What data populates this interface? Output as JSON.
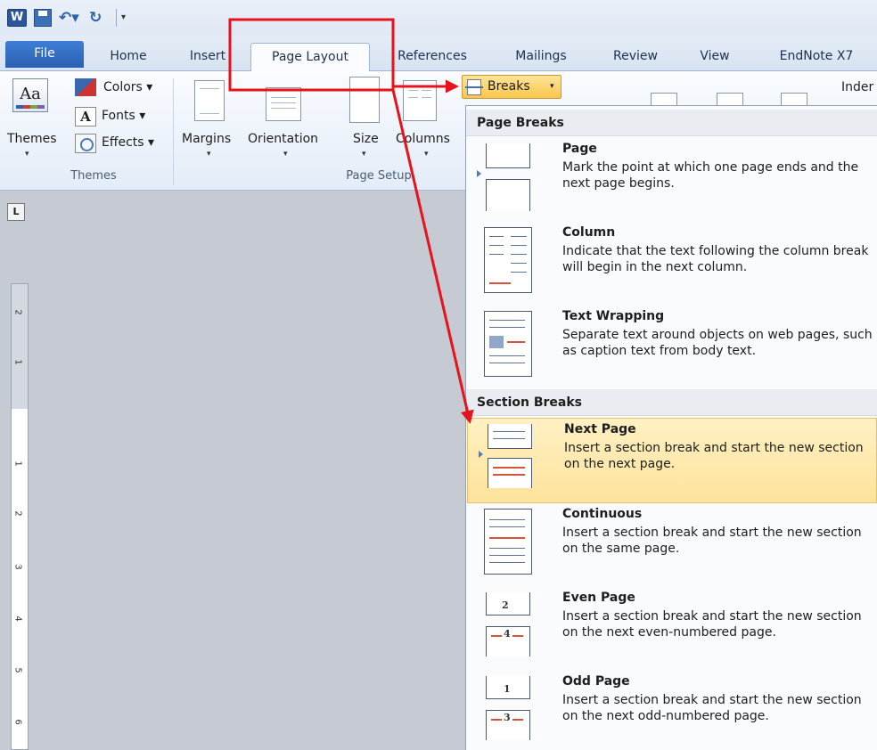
{
  "quick_access": {
    "word_icon": "W",
    "icons": [
      "word-icon",
      "save-icon",
      "undo-icon",
      "redo-icon",
      "customize-icon"
    ]
  },
  "tabs": [
    {
      "label": "File"
    },
    {
      "label": "Home"
    },
    {
      "label": "Insert"
    },
    {
      "label": "Page Layout"
    },
    {
      "label": "References"
    },
    {
      "label": "Mailings"
    },
    {
      "label": "Review"
    },
    {
      "label": "View"
    },
    {
      "label": "EndNote X7"
    }
  ],
  "ribbon": {
    "themes": {
      "button": "Themes",
      "colors": "Colors",
      "fonts": "Fonts",
      "effects": "Effects",
      "group": "Themes"
    },
    "page_setup": {
      "margins": "Margins",
      "orientation": "Orientation",
      "size": "Size",
      "columns": "Columns",
      "group": "Page Setup"
    },
    "breaks": "Breaks",
    "indent": "Inder"
  },
  "ruler": {
    "numbers": [
      "2",
      "1",
      "1",
      "2",
      "3",
      "4",
      "5",
      "6"
    ]
  },
  "breaks_menu": {
    "page_breaks_header": "Page Breaks",
    "section_breaks_header": "Section Breaks",
    "items": [
      {
        "title": "Page",
        "desc": "Mark the point at which one page ends and the next page begins."
      },
      {
        "title": "Column",
        "desc": "Indicate that the text following the column break will begin in the next column."
      },
      {
        "title": "Text Wrapping",
        "desc": "Separate text around objects on web pages, such as caption text from body text."
      },
      {
        "title": "Next Page",
        "desc": "Insert a section break and start the new section on the next page."
      },
      {
        "title": "Continuous",
        "desc": "Insert a section break and start the new section on the same page."
      },
      {
        "title": "Even Page",
        "desc": "Insert a section break and start the new section on the next even-numbered page."
      },
      {
        "title": "Odd Page",
        "desc": "Insert a section break and start the new section on the next odd-numbered page."
      }
    ],
    "even_numbers": [
      "2",
      "4"
    ],
    "odd_numbers": [
      "1",
      "3"
    ]
  },
  "colors": {
    "annotation": "#e8121b",
    "highlight": "#fde39b",
    "file_tab": "#2a5fb0"
  }
}
